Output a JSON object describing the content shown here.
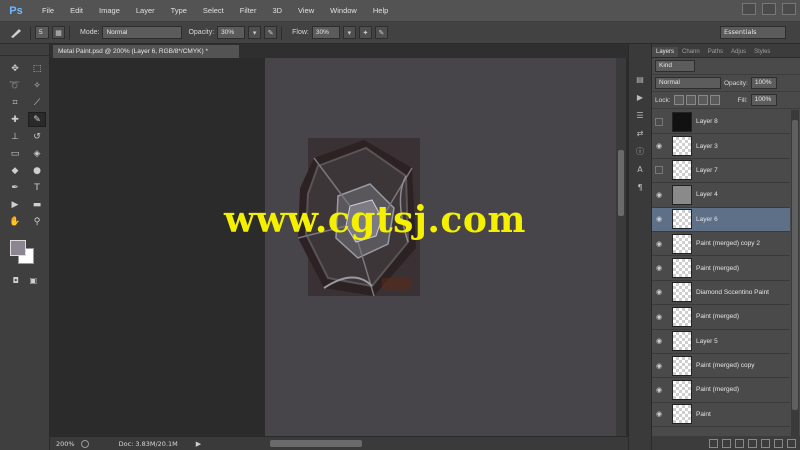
{
  "app": {
    "logo": "Ps"
  },
  "menu": [
    "File",
    "Edit",
    "Image",
    "Layer",
    "Type",
    "Select",
    "Filter",
    "3D",
    "View",
    "Window",
    "Help"
  ],
  "options": {
    "brush_size": "5",
    "mode_label": "Mode:",
    "mode_value": "Normal",
    "opacity_label": "Opacity:",
    "opacity_value": "30%",
    "flow_label": "Flow:",
    "flow_value": "30%",
    "workspace": "Essentials"
  },
  "document": {
    "tab_title": "Metal Paint.psd @ 200% (Layer 6, RGB/8*/CMYK) *",
    "zoom": "200%",
    "doc_info": "Doc: 3.83M/20.1M"
  },
  "watermark": "www.cgtsj.com",
  "layers_panel": {
    "tabs": [
      "Layers",
      "Chann",
      "Paths",
      "Adjus",
      "Styles"
    ],
    "kind_label": "Kind",
    "blend_mode": "Normal",
    "opacity_label": "Opacity:",
    "opacity_value": "100%",
    "lock_label": "Lock:",
    "fill_label": "Fill:",
    "fill_value": "100%",
    "layers": [
      {
        "name": "Layer 8",
        "visible": false,
        "thumb": "dark",
        "selected": false
      },
      {
        "name": "Layer 3",
        "visible": true,
        "thumb": "checker",
        "selected": false
      },
      {
        "name": "Layer 7",
        "visible": false,
        "thumb": "checker",
        "selected": false
      },
      {
        "name": "Layer 4",
        "visible": true,
        "thumb": "gray",
        "selected": false
      },
      {
        "name": "Layer 6",
        "visible": true,
        "thumb": "checker",
        "selected": true
      },
      {
        "name": "Paint (merged) copy 2",
        "visible": true,
        "thumb": "checker",
        "selected": false
      },
      {
        "name": "Paint (merged)",
        "visible": true,
        "thumb": "checker",
        "selected": false
      },
      {
        "name": "Diamond Sccentino Paint",
        "visible": true,
        "thumb": "checker",
        "selected": false
      },
      {
        "name": "Paint (merged)",
        "visible": true,
        "thumb": "checker",
        "selected": false
      },
      {
        "name": "Layer 5",
        "visible": true,
        "thumb": "checker",
        "selected": false
      },
      {
        "name": "Paint (merged) copy",
        "visible": true,
        "thumb": "checker",
        "selected": false
      },
      {
        "name": "Paint (merged)",
        "visible": true,
        "thumb": "checker",
        "selected": false
      },
      {
        "name": "Paint",
        "visible": true,
        "thumb": "checker",
        "selected": false
      }
    ]
  },
  "colors": {
    "foreground": "#8a8590",
    "background": "#ffffff",
    "selection": "#5e6f88",
    "watermark": "#f4f000"
  }
}
